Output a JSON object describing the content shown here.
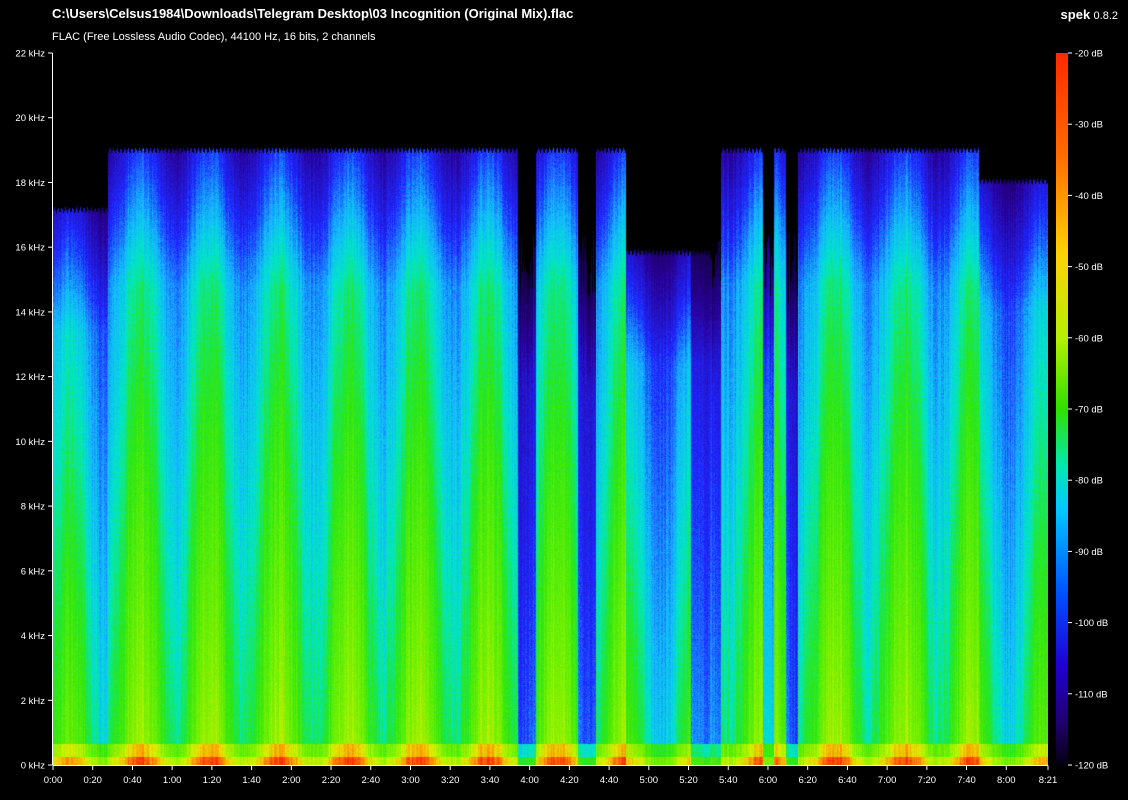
{
  "window": {
    "file_path": "C:\\Users\\Celsus1984\\Downloads\\Telegram Desktop\\03 Incognition (Original Mix).flac",
    "info": "FLAC (Free Lossless Audio Codec), 44100 Hz, 16 bits, 2 channels",
    "app_name": "spek",
    "app_version": "0.8.2"
  },
  "frequency_axis": {
    "unit": "kHz",
    "ticks": [
      "22 kHz",
      "20 kHz",
      "18 kHz",
      "16 kHz",
      "14 kHz",
      "12 kHz",
      "10 kHz",
      "8 kHz",
      "6 kHz",
      "4 kHz",
      "2 kHz",
      "0 kHz"
    ]
  },
  "time_axis": {
    "ticks": [
      "0:00",
      "0:20",
      "0:40",
      "1:00",
      "1:20",
      "1:40",
      "2:00",
      "2:20",
      "2:40",
      "3:00",
      "3:20",
      "3:40",
      "4:00",
      "4:20",
      "4:40",
      "5:00",
      "5:20",
      "5:40",
      "6:00",
      "6:20",
      "6:40",
      "7:00",
      "7:20",
      "7:40",
      "8:00",
      "8:21"
    ]
  },
  "db_scale": {
    "ticks": [
      "-20 dB",
      "-30 dB",
      "-40 dB",
      "-50 dB",
      "-60 dB",
      "-70 dB",
      "-80 dB",
      "-90 dB",
      "-100 dB",
      "-110 dB",
      "-120 dB"
    ]
  },
  "spectrogram": {
    "duration_seconds": 501,
    "max_frequency_khz": 22,
    "cutoff_khz": 19,
    "colors": {
      "background": "#000000",
      "floor": "#1a0048",
      "high_blue": "#2a14e0",
      "mid_cyan": "#10d8f0",
      "green": "#30e010",
      "yellow": "#d8f000",
      "orange": "#ff6a00"
    },
    "quiet_segments": [
      [
        3.9,
        4.05
      ],
      [
        4.4,
        4.55
      ],
      [
        5.35,
        5.6
      ],
      [
        5.95,
        6.05
      ],
      [
        6.15,
        6.25
      ]
    ]
  }
}
